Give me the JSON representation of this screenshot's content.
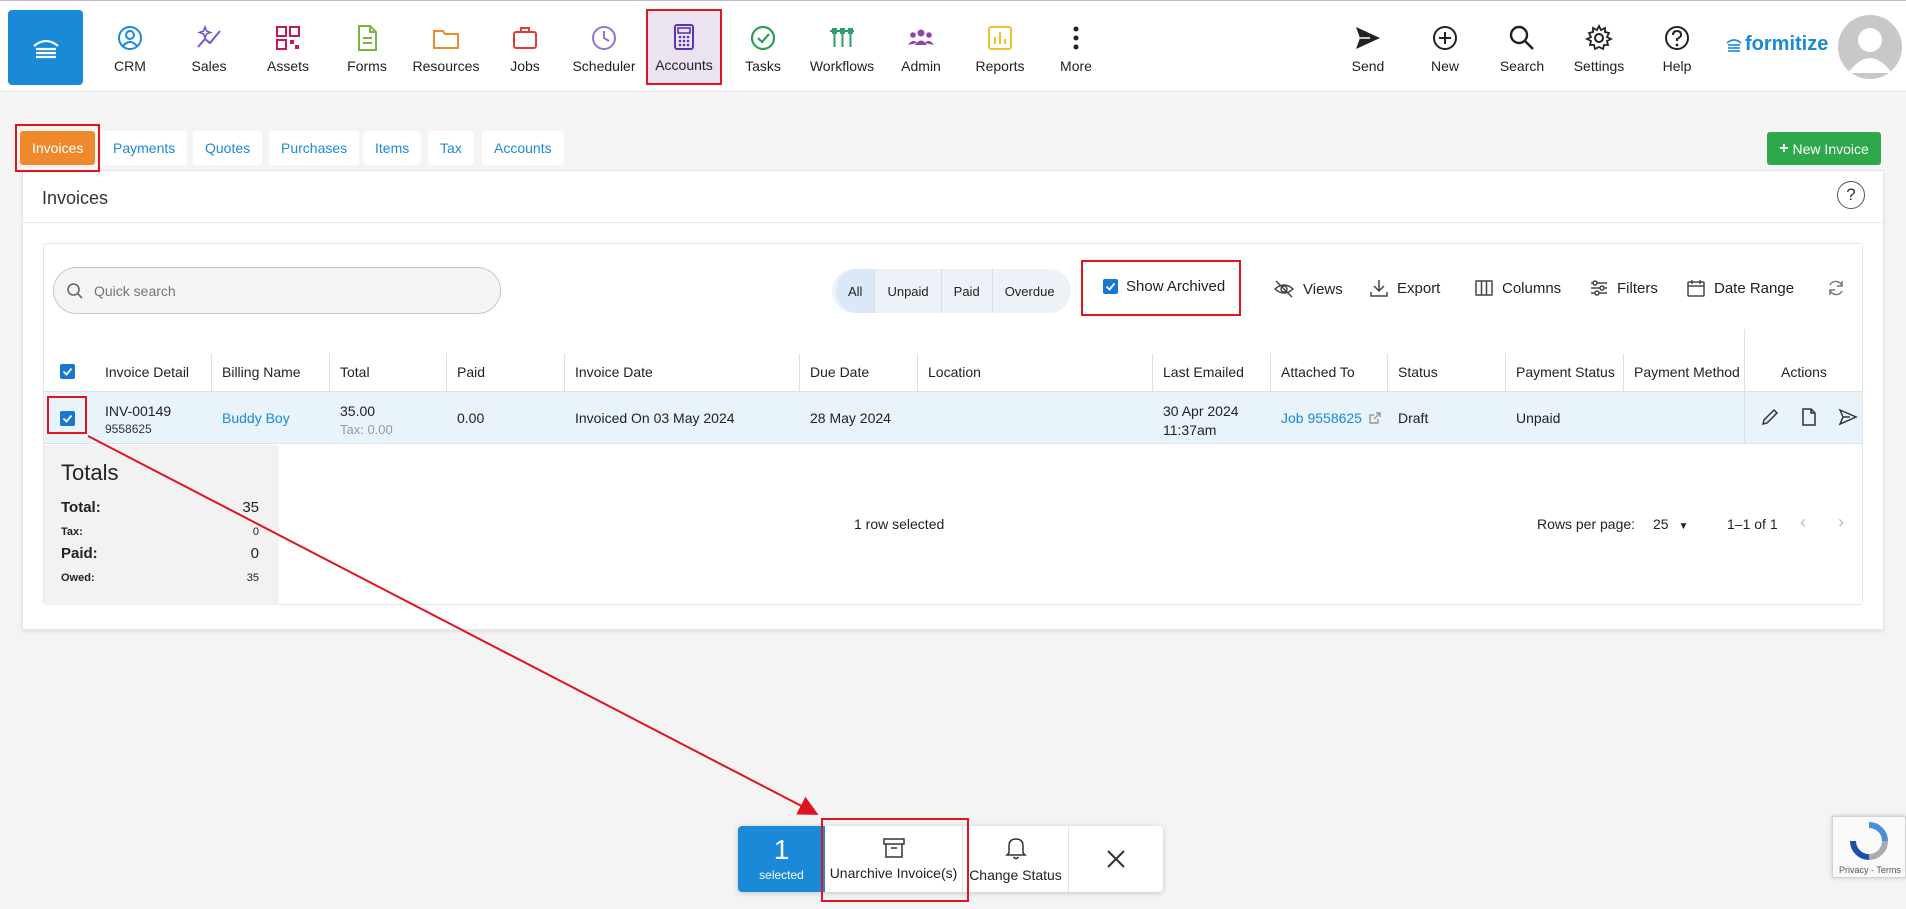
{
  "nav": {
    "items": [
      {
        "label": "CRM",
        "icon": "person-circle-icon",
        "color": "#1a8ad8"
      },
      {
        "label": "Sales",
        "icon": "sparkle-chart-icon",
        "color": "#6a5acd"
      },
      {
        "label": "Assets",
        "icon": "qr-code-icon",
        "color": "#c2185b"
      },
      {
        "label": "Forms",
        "icon": "document-icon",
        "color": "#7cb342"
      },
      {
        "label": "Resources",
        "icon": "folder-icon",
        "color": "#ef8a2b"
      },
      {
        "label": "Jobs",
        "icon": "briefcase-icon",
        "color": "#e53935"
      },
      {
        "label": "Scheduler",
        "icon": "clock-icon",
        "color": "#9575cd"
      },
      {
        "label": "Accounts",
        "icon": "calculator-icon",
        "color": "#5e35b1"
      },
      {
        "label": "Tasks",
        "icon": "check-circle-icon",
        "color": "#2e9e4f"
      },
      {
        "label": "Workflows",
        "icon": "workflow-icon",
        "color": "#2e9e6f"
      },
      {
        "label": "Admin",
        "icon": "people-icon",
        "color": "#8e44ad"
      },
      {
        "label": "Reports",
        "icon": "bar-chart-icon",
        "color": "#f2c037"
      },
      {
        "label": "More",
        "icon": "more-vertical-icon",
        "color": "#222222"
      }
    ],
    "right": [
      {
        "label": "Send",
        "icon": "send-icon"
      },
      {
        "label": "New",
        "icon": "plus-circle-icon"
      },
      {
        "label": "Search",
        "icon": "search-icon"
      },
      {
        "label": "Settings",
        "icon": "gear-icon"
      },
      {
        "label": "Help",
        "icon": "help-circle-icon"
      }
    ],
    "brand": "formitize",
    "active": "Accounts"
  },
  "tabs": [
    "Invoices",
    "Payments",
    "Quotes",
    "Purchases",
    "Items",
    "Tax",
    "Accounts"
  ],
  "new_invoice_label": "New Invoice",
  "card": {
    "title": "Invoices",
    "search_placeholder": "Quick search",
    "filters": [
      "All",
      "Unpaid",
      "Paid",
      "Overdue"
    ],
    "show_archived": "Show Archived",
    "tools": {
      "views": "Views",
      "export": "Export",
      "columns": "Columns",
      "filters": "Filters",
      "date_range": "Date Range"
    }
  },
  "table": {
    "columns": {
      "invoice_detail": "Invoice Detail",
      "billing_name": "Billing Name",
      "total": "Total",
      "paid": "Paid",
      "invoice_date": "Invoice Date",
      "due_date": "Due Date",
      "location": "Location",
      "last_emailed": "Last Emailed",
      "attached_to": "Attached To",
      "status": "Status",
      "payment_status": "Payment Status",
      "payment_method": "Payment Method",
      "actions": "Actions"
    },
    "row": {
      "invoice_no": "INV-00149",
      "invoice_sub": "9558625",
      "billing_name": "Buddy Boy",
      "total": "35.00",
      "tax": "Tax: 0.00",
      "paid": "0.00",
      "invoice_date": "Invoiced On 03 May 2024",
      "due_date": "28 May 2024",
      "last_emailed_date": "30 Apr 2024",
      "last_emailed_time": "11:37am",
      "attached_to": "Job 9558625",
      "status": "Draft",
      "payment_status": "Unpaid"
    }
  },
  "totals": {
    "title": "Totals",
    "total_label": "Total:",
    "total_value": "35",
    "tax_label": "Tax:",
    "tax_value": "0",
    "paid_label": "Paid:",
    "paid_value": "0",
    "owed_label": "Owed:",
    "owed_value": "35"
  },
  "footer": {
    "selected_text": "1 row selected",
    "rows_per_page_label": "Rows per page:",
    "rows_per_page": "25",
    "range": "1–1 of 1"
  },
  "actionbar": {
    "count": "1",
    "count_label": "selected",
    "unarchive": "Unarchive Invoice(s)",
    "change_status": "Change Status"
  },
  "recaptcha": "Privacy - Terms"
}
